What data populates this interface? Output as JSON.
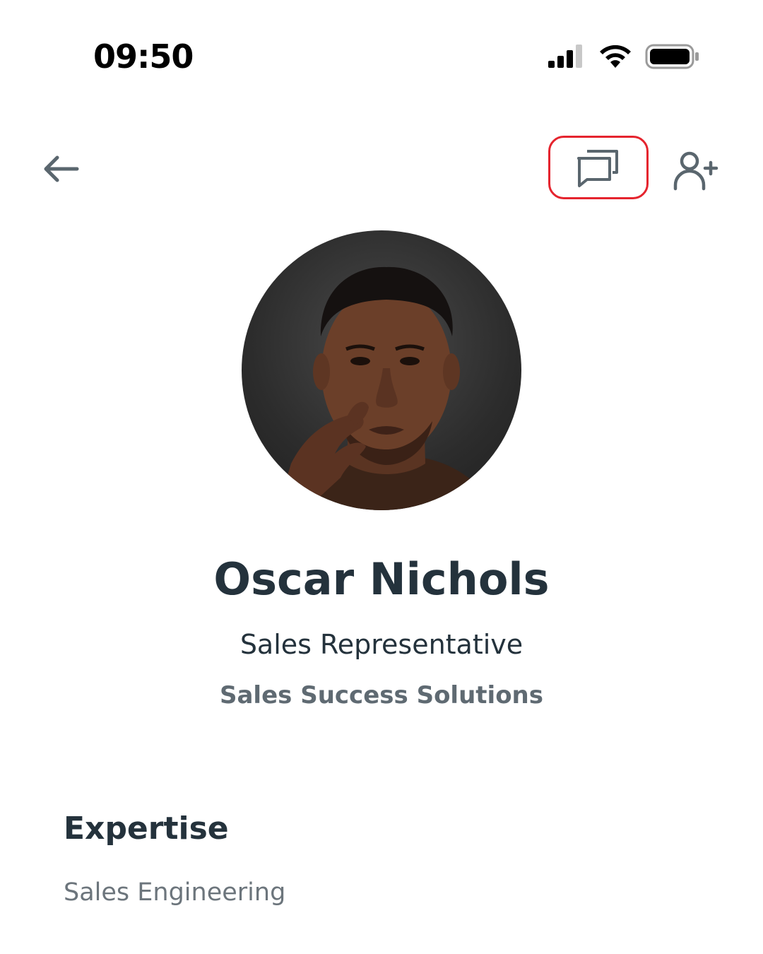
{
  "status_bar": {
    "time": "09:50",
    "icons": [
      "cellular-signal-icon",
      "wifi-icon",
      "battery-icon"
    ]
  },
  "nav": {
    "back_icon": "arrow-left-icon",
    "message_icon": "chat-bubbles-icon",
    "add_contact_icon": "add-user-icon",
    "highlight_color": "#e5242e"
  },
  "profile": {
    "name": "Oscar Nichols",
    "title": "Sales Representative",
    "company": "Sales Success Solutions"
  },
  "expertise": {
    "heading": "Expertise",
    "items": [
      "Sales Engineering"
    ]
  },
  "colors": {
    "text_primary": "#24323c",
    "text_secondary": "#5f6a72",
    "text_muted": "#6c757c",
    "icon": "#5a666e"
  }
}
